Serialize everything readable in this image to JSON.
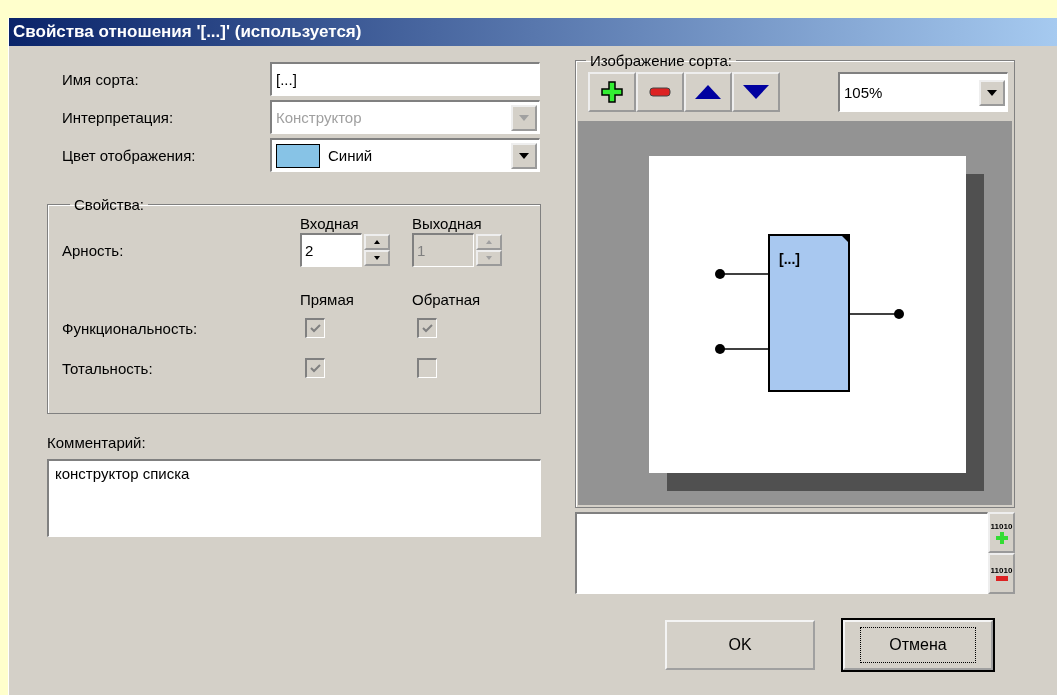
{
  "window": {
    "title": "Свойства отношения '[...]' (используется)"
  },
  "fields": [
    {
      "label": "Имя сорта:",
      "kind": "text",
      "value": "[...]",
      "disabled": false
    },
    {
      "label": "Интерпретация:",
      "kind": "combo",
      "value": "Конструктор",
      "disabled": true
    },
    {
      "label": "Цвет отображения:",
      "kind": "color-combo",
      "value": "Синий",
      "color": "#87c3e6",
      "disabled": false
    }
  ],
  "properties": {
    "title": "Свойства:",
    "arity_label": "Арность:",
    "arity_columns": [
      "Входная",
      "Выходная"
    ],
    "spinners": [
      {
        "value": "2",
        "disabled": false
      },
      {
        "value": "1",
        "disabled": true
      }
    ],
    "check_columns": [
      "Прямая",
      "Обратная"
    ],
    "check_rows": [
      {
        "label": "Функциональность:",
        "checks": [
          {
            "checked": true,
            "disabled": true
          },
          {
            "checked": true,
            "disabled": true
          }
        ]
      },
      {
        "label": "Тотальность:",
        "checks": [
          {
            "checked": true,
            "disabled": true
          },
          {
            "checked": false,
            "disabled": true
          }
        ]
      }
    ]
  },
  "comment": {
    "label": "Комментарий:",
    "value": "конструктор списка"
  },
  "image": {
    "title": "Изображение сорта:",
    "zoom": "105%",
    "node_label": "[...]",
    "toolbar": [
      {
        "kind": "add"
      },
      {
        "kind": "remove"
      },
      {
        "kind": "up"
      },
      {
        "kind": "down"
      }
    ],
    "side_buttons": [
      {
        "kind": "add",
        "icon_text": "11010"
      },
      {
        "kind": "remove",
        "icon_text": "11010"
      }
    ]
  },
  "buttons": [
    {
      "label": "OK",
      "focused": false
    },
    {
      "label": "Отмена",
      "focused": true
    }
  ]
}
